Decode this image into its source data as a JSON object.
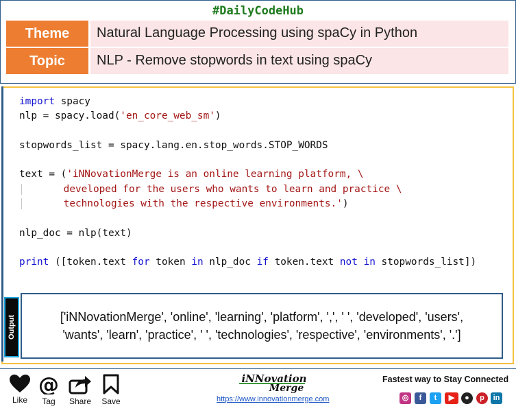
{
  "header": {
    "hashtag": "#DailyCodeHub",
    "theme_label": "Theme",
    "theme_value": "Natural Language Processing using spaCy in Python",
    "topic_label": "Topic",
    "topic_value": "NLP - Remove stopwords in text using spaCy"
  },
  "code": {
    "line1_kw": "import",
    "line1_rest": " spacy",
    "line2_pre": "nlp = spacy.load(",
    "line2_str": "'en_core_web_sm'",
    "line2_post": ")",
    "line4": "stopwords_list = spacy.lang.en.stop_words.STOP_WORDS",
    "line6_pre": "text = (",
    "line6_str": "'iNNovationMerge is an online learning platform, \\",
    "line7_str": "developed for the users who wants to learn and practice \\",
    "line8_str": "technologies with the respective environments.'",
    "line8_post": ")",
    "line10": "nlp_doc = nlp(text)",
    "line12_print": "print",
    "line12_a": " ([token.text ",
    "line12_for": "for",
    "line12_b": " token ",
    "line12_in1": "in",
    "line12_c": " nlp_doc ",
    "line12_if": "if",
    "line12_d": " token.text ",
    "line12_not": "not",
    "line12_e": " ",
    "line12_in2": "in",
    "line12_f": " stopwords_list])"
  },
  "output": {
    "label": "Output",
    "line1": "['iNNovationMerge', 'online', 'learning', 'platform', ',', ' ', 'developed', 'users',",
    "line2": "'wants', 'learn', 'practice', ' ', 'technologies', 'respective', 'environments', '.']"
  },
  "footer": {
    "like": "Like",
    "tag": "Tag",
    "share": "Share",
    "save": "Save",
    "logo_main": "iNNovation",
    "logo_sub": "Merge",
    "url": "https://www.innovationmerge.com",
    "tagline": "Fastest way to Stay Connected",
    "icons": [
      "instagram-icon",
      "facebook-icon",
      "twitter-icon",
      "youtube-icon",
      "github-icon",
      "pinterest-icon",
      "linkedin-icon"
    ]
  },
  "colors": {
    "accent_orange": "#ed7d31",
    "row_bg": "#fbe5e6",
    "border_blue": "#2e5c8a",
    "border_gold": "#f5c242",
    "hashtag_green": "#1e7b1e"
  }
}
